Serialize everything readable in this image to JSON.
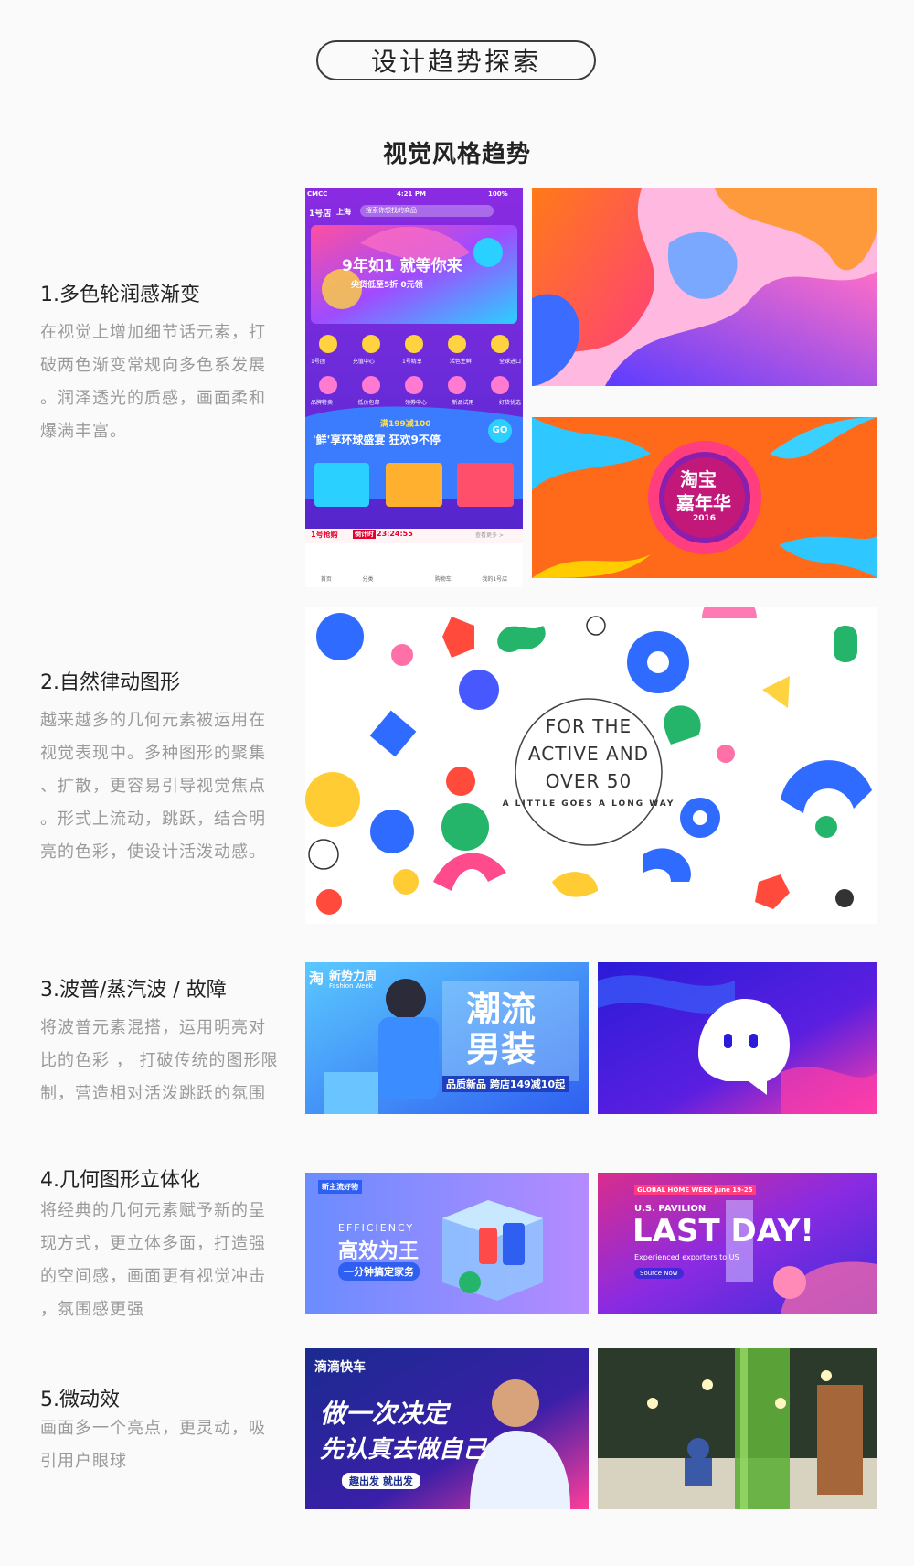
{
  "header": {
    "pill_title": "设计趋势探索",
    "subtitle": "视觉风格趋势"
  },
  "sections": [
    {
      "title": "1.多色轮润感渐变",
      "desc": [
        "在视觉上增加细节话元素，打",
        "破两色渐变常规向多色系发展",
        "。润泽透光的质感，画面柔和",
        "爆满丰富。"
      ]
    },
    {
      "title": "2.自然律动图形",
      "desc": [
        "越来越多的几何元素被运用在",
        "视觉表现中。多种图形的聚集",
        "、扩散，更容易引导视觉焦点",
        "。形式上流动，跳跃，结合明",
        "亮的色彩，使设计活泼动感。"
      ]
    },
    {
      "title": "3.波普/蒸汽波 / 故障",
      "desc": [
        "将波普元素混搭，运用明亮对",
        "比的色彩 ， 打破传统的图形限",
        "制，营造相对活泼跳跃的氛围"
      ]
    },
    {
      "title": "4.几何图形立体化",
      "desc": [
        "将经典的几何元素赋予新的呈",
        "现方式，更立体多面，打造强",
        "的空间感，画面更有视觉冲击",
        "，氛围感更强"
      ]
    },
    {
      "title": "5.微动效",
      "desc": [
        "画面多一个亮点，更灵动，吸",
        "引用户眼球"
      ]
    }
  ],
  "images": {
    "phone": {
      "status": [
        "CMCC",
        "4:21 PM",
        "100%"
      ],
      "brand": "1号店",
      "city": "上海",
      "search_placeholder": "搜索你想找的商品",
      "banner_title": "9年如1 就等你来",
      "banner_sub": "尖货低至5折  0元领",
      "icons_row1": [
        "1号团",
        "充值中心",
        "1号精享",
        "活色生鲜",
        "全球进口"
      ],
      "icons_row2": [
        "品牌特卖",
        "低价包邮",
        "领券中心",
        "新品试用",
        "好货优选"
      ],
      "promo_top": "满199减100",
      "promo_main": "'鲜'享环球盛宴 狂欢9不停",
      "go": "GO",
      "flash_label": "1号抢购",
      "flash_tag": "倒计时",
      "flash_time": "23:24:55",
      "flash_more": "查看更多 >",
      "tabbar": [
        "首页",
        "分类",
        "",
        "购物车",
        "我的1号店"
      ]
    },
    "carnival": {
      "line1": "淘宝",
      "line2": "嘉年华",
      "year": "2016"
    },
    "active": {
      "line1": "FOR THE",
      "line2": "ACTIVE AND",
      "line3": "OVER 50",
      "tagline": "A LITTLE GOES A LONG WAY"
    },
    "fashion": {
      "brand": "淘",
      "week_cn": "新势力周",
      "week_en": "Fashion Week",
      "title1": "潮流",
      "title2": "男装",
      "sub": "品质新品 跨店149减10起"
    },
    "efficiency": {
      "badge": "新主流好物",
      "en": "EFFICIENCY",
      "title": "高效为王",
      "sub": "一分钟搞定家务"
    },
    "lastday": {
      "top": "GLOBAL HOME WEEK  june 19-25",
      "pav": "U.S. PAVILION",
      "title": "LAST DAY!",
      "sub": "Experienced exporters to US",
      "btn": "Source Now"
    },
    "didi": {
      "brand": "滴滴快车",
      "line1": "做一次决定",
      "line2": "先认真去做自己",
      "tag": "趣出发 就出发"
    }
  },
  "colors": {
    "accent_purple": "#6a2bd8",
    "accent_orange": "#ff6a1a",
    "accent_blue": "#2f5ff0",
    "text_gray": "#9a9a9a"
  }
}
